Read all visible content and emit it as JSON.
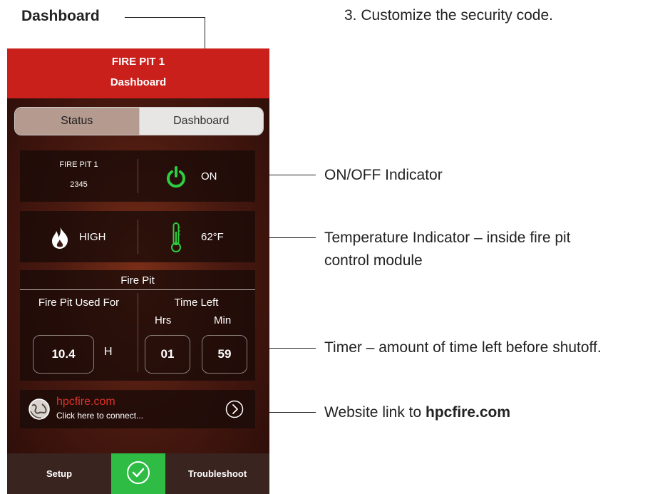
{
  "annotations": {
    "dashboard": "Dashboard",
    "step": "3. Customize the security code.",
    "onoff": "ON/OFF  Indicator",
    "temp_line1": "Temperature Indicator – inside fire pit",
    "temp_line2": "control module",
    "timer": "Timer – amount of time left before shutoff.",
    "website_prefix": "Website link to ",
    "website_bold": "hpcfire.com"
  },
  "app": {
    "title": "FIRE PIT 1",
    "subtitle": "Dashboard",
    "tabs": [
      {
        "label": "Status",
        "active": false
      },
      {
        "label": "Dashboard",
        "active": true
      }
    ],
    "device": {
      "name": "FIRE PIT 1",
      "code": "2345"
    },
    "power": {
      "state": "ON"
    },
    "flame": {
      "level": "HIGH"
    },
    "temperature": {
      "value": "62°F"
    },
    "firepit": {
      "section_title": "Fire Pit",
      "used_label": "Fire Pit Used For",
      "used_value": "10.4",
      "used_unit": "H",
      "time_left_label": "Time Left",
      "hrs_label": "Hrs",
      "min_label": "Min",
      "hrs_value": "01",
      "min_value": "59"
    },
    "website": {
      "name": "hpcfire.com",
      "caption": "Click here to connect..."
    },
    "bottom_nav": {
      "setup": "Setup",
      "troubleshoot": "Troubleshoot"
    },
    "colors": {
      "header": "#c9201c",
      "power_green": "#2ecc40",
      "confirm_green": "#2fbc45",
      "link_red": "#e0312a"
    }
  }
}
